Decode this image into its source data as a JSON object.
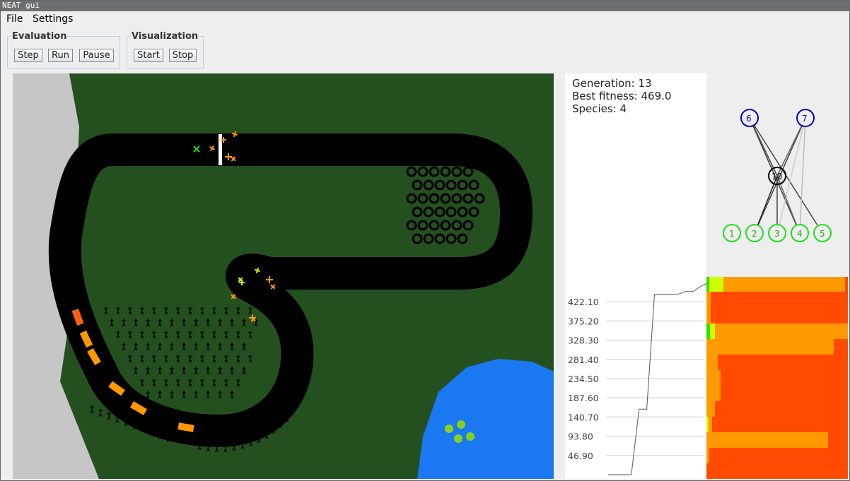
{
  "window": {
    "title": "NEAT gui"
  },
  "menu": {
    "file": "File",
    "settings": "Settings"
  },
  "evaluation": {
    "title": "Evaluation",
    "step": "Step",
    "run": "Run",
    "pause": "Pause"
  },
  "visualization": {
    "title": "Visualization",
    "start": "Start",
    "stop": "Stop"
  },
  "stats": {
    "generation": "Generation: 13",
    "best_fitness": "Best fitness: 469.0",
    "species": "Species: 4"
  },
  "network": {
    "nodes": [
      {
        "id": "1",
        "type": "input"
      },
      {
        "id": "2",
        "type": "input"
      },
      {
        "id": "3",
        "type": "input"
      },
      {
        "id": "4",
        "type": "input"
      },
      {
        "id": "5",
        "type": "input"
      },
      {
        "id": "6",
        "type": "output"
      },
      {
        "id": "7",
        "type": "output"
      },
      {
        "id": "10",
        "type": "hidden"
      }
    ],
    "colors": {
      "input": "#22dd22",
      "output": "#0000cc",
      "hidden": "#000000"
    }
  },
  "chart_data": {
    "type": "line",
    "y_ticks": [
      "422.10",
      "375.20",
      "328.30",
      "281.40",
      "234.50",
      "187.60",
      "140.70",
      "93.80",
      "46.90"
    ],
    "ylim": [
      0,
      469
    ],
    "series": [
      {
        "values": [
          0,
          0,
          0,
          0,
          160,
          160,
          440,
          440,
          440,
          440,
          447,
          447,
          460,
          469
        ]
      }
    ]
  },
  "species_colors": [
    "#ff4a00",
    "#ff9900",
    "#ccff00",
    "#33dd00"
  ]
}
